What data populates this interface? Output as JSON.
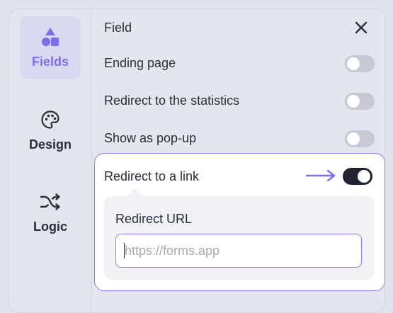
{
  "sidebar": {
    "items": [
      {
        "label": "Fields",
        "icon": "shapes-icon",
        "active": true
      },
      {
        "label": "Design",
        "icon": "palette-icon",
        "active": false
      },
      {
        "label": "Logic",
        "icon": "shuffle-icon",
        "active": false
      }
    ]
  },
  "header": {
    "title": "Field",
    "close_icon": "close-icon"
  },
  "settings": {
    "rows": [
      {
        "label": "Ending page",
        "on": false
      },
      {
        "label": "Redirect to the statistics",
        "on": false
      },
      {
        "label": "Show as pop-up",
        "on": false
      }
    ],
    "redirect_link": {
      "label": "Redirect to a link",
      "on": true,
      "url_label": "Redirect URL",
      "url_value": "",
      "url_placeholder": "https://forms.app"
    }
  },
  "colors": {
    "accent": "#7d6ef0",
    "toggle_on": "#202233",
    "toggle_off": "#c4c9d4"
  }
}
